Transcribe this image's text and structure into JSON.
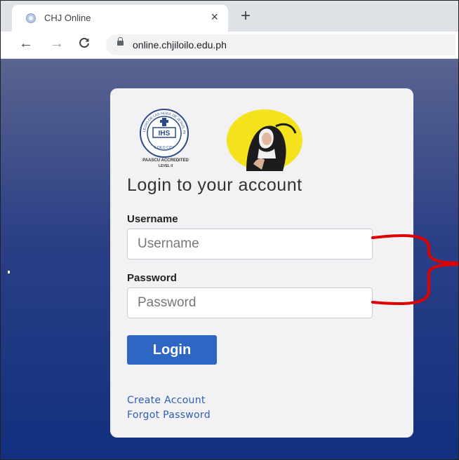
{
  "browser": {
    "tab_title": "CHJ Online",
    "tab_close": "×",
    "new_tab": "+",
    "back": "←",
    "forward": "→",
    "reload": "C",
    "url": "online.chjiloilo.edu.ph"
  },
  "card": {
    "seal_text": "COLEGIO DE LAS HIJAS DE JESUS, INC.",
    "seal_abbrev": "IHS",
    "seal_city": "ILOILO CITY",
    "accreditation": "PAASCU ACCREDITED",
    "accreditation_level": "LEVEL II",
    "title": "Login to your account",
    "username_label": "Username",
    "username_placeholder": "Username",
    "password_label": "Password",
    "password_placeholder": "Password",
    "login_button": "Login",
    "create_account": "Create Account",
    "forgot_password": "Forgot Password"
  },
  "colors": {
    "accent": "#2d66c3",
    "annotation": "#e00000",
    "page_background": "#1a347f"
  }
}
